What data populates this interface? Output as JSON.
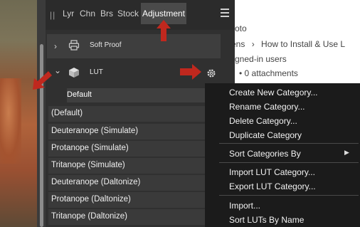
{
  "tabs": {
    "items": [
      {
        "label": "Lyr"
      },
      {
        "label": "Chn"
      },
      {
        "label": "Brs"
      },
      {
        "label": "Stock"
      },
      {
        "label": "Adjustment"
      }
    ]
  },
  "soft_proof": {
    "label": "Soft Proof"
  },
  "lut": {
    "label": "LUT",
    "category": "Default"
  },
  "list": {
    "items": [
      {
        "label": "(Default)"
      },
      {
        "label": "Deuteranope (Simulate)"
      },
      {
        "label": "Protanope (Simulate)"
      },
      {
        "label": "Tritanope (Simulate)"
      },
      {
        "label": "Deuteranope (Daltonize)"
      },
      {
        "label": "Protanope (Daltonize)"
      },
      {
        "label": "Tritanope (Daltonize)"
      }
    ]
  },
  "context_menu": {
    "items": [
      {
        "label": "Create New Category..."
      },
      {
        "label": "Rename Category..."
      },
      {
        "label": "Delete Category..."
      },
      {
        "label": "Duplicate Category"
      },
      {
        "label": "Sort Categories By"
      },
      {
        "label": "Import LUT Category..."
      },
      {
        "label": "Export LUT Category..."
      },
      {
        "label": "Import..."
      },
      {
        "label": "Sort LUTs By Name"
      }
    ]
  },
  "background_page": {
    "line1": "oto",
    "line2": "ens",
    "line2_rest": "How to Install & Use L",
    "line3": "gned-in users",
    "line4": "0 attachments"
  },
  "colors": {
    "annotation_arrow": "#c0281e",
    "panel": "#303030",
    "menu": "#1b1b1b"
  },
  "icons": [
    "printer-icon",
    "cube-icon",
    "gear-icon",
    "hamburger-menu-icon"
  ]
}
